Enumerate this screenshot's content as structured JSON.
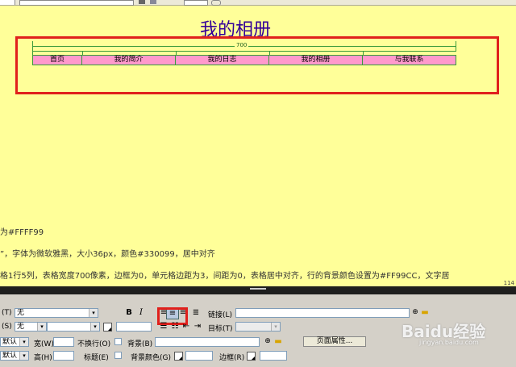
{
  "page": {
    "title": "我的相册",
    "table_width_label": "700",
    "nav": [
      "首页",
      "我的简介",
      "我的日志",
      "我的相册",
      "与我联系"
    ],
    "text_lines": [
      "为#FFFF99",
      "”，字体为微软雅黑，大小36px，颜色#330099，居中对齐",
      "格1行5列，表格宽度700像素，边框为0，单元格边距为3，间距为0，表格居中对齐，行的背景颜色设置为#FF99CC，文字居"
    ],
    "status_right": "114"
  },
  "properties": {
    "row1": {
      "format_label": "(T)",
      "format_value": "无",
      "bold": "B",
      "italic": "I",
      "link_label": "链接(L)"
    },
    "row2": {
      "style_label": "(S)",
      "style_value": "无",
      "target_label": "目标(T)"
    },
    "row3": {
      "horz_value": "默认",
      "width_label": "宽(W)",
      "nowrap_label": "不换行(O)",
      "bg_label": "背景(B)",
      "page_props_button": "页面属性..."
    },
    "row4": {
      "vert_value": "默认",
      "height_label": "高(H)",
      "header_label": "标题(E)",
      "bgcolor_label": "背景颜色(G)",
      "border_label": "边框(R)"
    }
  },
  "watermark": {
    "brand": "Baidu经验",
    "url": "jingyan.baidu.com"
  },
  "colors": {
    "design_bg": "#ffff99",
    "title_color": "#330099",
    "nav_bg": "#ff99cc",
    "highlight": "#e0201c"
  }
}
